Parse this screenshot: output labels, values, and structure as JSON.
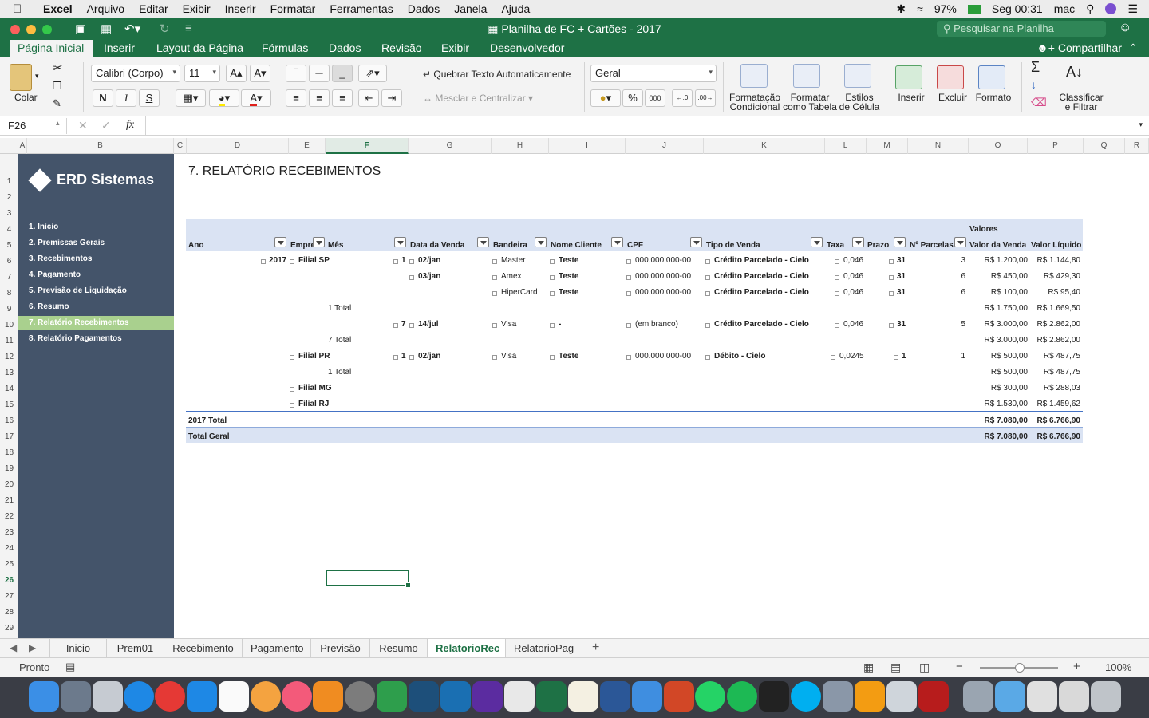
{
  "menubar": {
    "app": "Excel",
    "items": [
      "Arquivo",
      "Editar",
      "Exibir",
      "Inserir",
      "Formatar",
      "Ferramentas",
      "Dados",
      "Janela",
      "Ajuda"
    ],
    "battery": "97%",
    "clock": "Seg 00:31",
    "user": "mac"
  },
  "window": {
    "title": "Planilha de FC + Cartões - 2017",
    "search_placeholder": "Pesquisar na Planilha"
  },
  "ribbon_tabs": [
    "Página Inicial",
    "Inserir",
    "Layout da Página",
    "Fórmulas",
    "Dados",
    "Revisão",
    "Exibir",
    "Desenvolvedor"
  ],
  "share": "Compartilhar",
  "ribbon": {
    "paste": "Colar",
    "font": "Calibri (Corpo)",
    "size": "11",
    "bold": "N",
    "italic": "I",
    "underline": "S",
    "wrap": "Quebrar Texto Automaticamente",
    "merge": "Mesclar e Centralizar",
    "numfmt": "Geral",
    "percent": "%",
    "thousands": "000",
    "cond_fmt": [
      "Formatação",
      "Condicional"
    ],
    "fmt_table": [
      "Formatar",
      "como Tabela"
    ],
    "cell_styles": [
      "Estilos",
      "de Célula"
    ],
    "insert": "Inserir",
    "delete": "Excluir",
    "format": "Formato",
    "sort_filter": [
      "Classificar",
      "e Filtrar"
    ]
  },
  "formula_bar": {
    "namebox": "F26",
    "fx": "fx",
    "value": ""
  },
  "columns": [
    "A",
    "B",
    "C",
    "D",
    "E",
    "F",
    "G",
    "H",
    "I",
    "J",
    "K",
    "L",
    "M",
    "N",
    "O",
    "P",
    "Q",
    "R"
  ],
  "rows": [
    "1",
    "2",
    "3",
    "4",
    "5",
    "6",
    "7",
    "8",
    "9",
    "10",
    "11",
    "12",
    "13",
    "14",
    "15",
    "16",
    "17",
    "18",
    "19",
    "20",
    "21",
    "22",
    "23",
    "24",
    "25",
    "26",
    "27",
    "28",
    "29"
  ],
  "sidebar": {
    "logo": "ERD Sistemas",
    "items": [
      "1. Inicio",
      "2. Premissas Gerais",
      "3. Recebimentos",
      "4. Pagamento",
      "5. Previsão de Liquidação",
      "6. Resumo",
      "7. Relatório Recebimentos",
      "8. Relatório Pagamentos"
    ]
  },
  "sheet_title": "7. RELATÓRIO RECEBIMENTOS",
  "pivot": {
    "values_label": "Valores",
    "headers": [
      "Ano",
      "Empre",
      "Mês",
      "Data da Venda",
      "Bandeira",
      "Nome Cliente",
      "CPF",
      "Tipo de Venda",
      "Taxa",
      "Prazo",
      "Nº Parcelas",
      "Valor da Venda",
      "Valor Líquido"
    ],
    "rows": [
      {
        "ano": "2017",
        "emp": "Filial SP",
        "mes": "1",
        "data": "02/jan",
        "band": "Master",
        "cli": "Teste",
        "cpf": "000.000.000-00",
        "tipo": "Crédito Parcelado - Cielo",
        "taxa": "0,046",
        "prazo": "31",
        "parc": "3",
        "venda": "R$ 1.200,00",
        "liq": "R$ 1.144,80"
      },
      {
        "ano": "",
        "emp": "",
        "mes": "",
        "data": "03/jan",
        "band": "Amex",
        "cli": "Teste",
        "cpf": "000.000.000-00",
        "tipo": "Crédito Parcelado - Cielo",
        "taxa": "0,046",
        "prazo": "31",
        "parc": "6",
        "venda": "R$ 450,00",
        "liq": "R$ 429,30"
      },
      {
        "ano": "",
        "emp": "",
        "mes": "",
        "data": "",
        "band": "HiperCard",
        "cli": "Teste",
        "cpf": "000.000.000-00",
        "tipo": "Crédito Parcelado - Cielo",
        "taxa": "0,046",
        "prazo": "31",
        "parc": "6",
        "venda": "R$ 100,00",
        "liq": "R$ 95,40"
      },
      {
        "total": "1 Total",
        "venda": "R$ 1.750,00",
        "liq": "R$ 1.669,50"
      },
      {
        "ano": "",
        "emp": "",
        "mes": "7",
        "data": "14/jul",
        "band": "Visa",
        "cli": "-",
        "cpf": "(em branco)",
        "tipo": "Crédito Parcelado - Cielo",
        "taxa": "0,046",
        "prazo": "31",
        "parc": "5",
        "venda": "R$ 3.000,00",
        "liq": "R$ 2.862,00"
      },
      {
        "total": "7 Total",
        "venda": "R$ 3.000,00",
        "liq": "R$ 2.862,00"
      },
      {
        "ano": "",
        "emp": "Filial PR",
        "mes": "1",
        "data": "02/jan",
        "band": "Visa",
        "cli": "Teste",
        "cpf": "000.000.000-00",
        "tipo": "Débito - Cielo",
        "taxa": "0,0245",
        "prazo": "1",
        "parc": "1",
        "venda": "R$ 500,00",
        "liq": "R$ 487,75"
      },
      {
        "total": "1 Total",
        "venda": "R$ 500,00",
        "liq": "R$ 487,75"
      },
      {
        "emp": "Filial MG",
        "venda": "R$ 300,00",
        "liq": "R$ 288,03"
      },
      {
        "emp": "Filial RJ",
        "venda": "R$ 1.530,00",
        "liq": "R$ 1.459,62"
      }
    ],
    "year_total": {
      "label": "2017 Total",
      "venda": "R$ 7.080,00",
      "liq": "R$ 6.766,90"
    },
    "grand_total": {
      "label": "Total Geral",
      "venda": "R$ 7.080,00",
      "liq": "R$ 6.766,90"
    }
  },
  "sheet_tabs": [
    "Inicio",
    "Prem01",
    "Recebimento",
    "Pagamento",
    "Previsão",
    "Resumo",
    "RelatorioRec",
    "RelatorioPag"
  ],
  "active_tab": "RelatorioRec",
  "status": {
    "text": "Pronto",
    "zoom": "100%"
  },
  "colors": {
    "excel_green": "#1e7145",
    "sidebar": "#44546a",
    "nav_active": "#a9d08e",
    "pivot_header": "#dae3f3"
  }
}
